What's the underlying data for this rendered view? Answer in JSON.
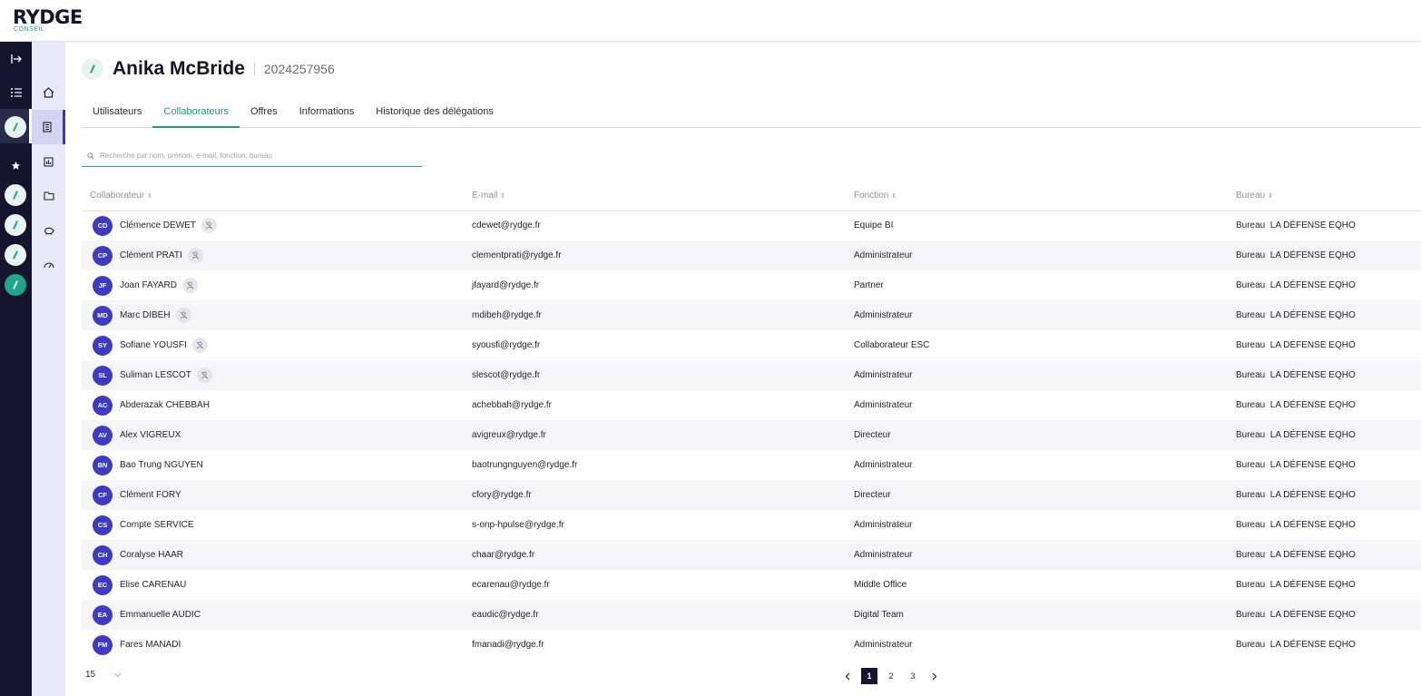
{
  "brand": {
    "name": "RYDGE",
    "sub": "CONSEIL"
  },
  "rail": {
    "items": [
      "expand-icon",
      "list-icon",
      "client-item-1",
      "favorites-icon",
      "client-item-2",
      "client-item-3",
      "client-item-4",
      "client-item-5"
    ]
  },
  "sidebar": {
    "items": [
      "home-icon",
      "building-icon",
      "report-icon",
      "folder-icon",
      "piggy-bank-icon",
      "gauge-icon"
    ]
  },
  "header": {
    "title": "Anika McBride",
    "id": "2024257956"
  },
  "tabs": [
    {
      "label": "Utilisateurs",
      "active": false
    },
    {
      "label": "Collaborateurs",
      "active": true
    },
    {
      "label": "Offres",
      "active": false
    },
    {
      "label": "Informations",
      "active": false
    },
    {
      "label": "Historique des délégations",
      "active": false
    }
  ],
  "search": {
    "placeholder": "Recherche par nom, prénom, e-mail, fonction, bureau"
  },
  "table": {
    "columns": [
      "Collaborateur",
      "E-mail",
      "Fonction",
      "Bureau"
    ],
    "rows": [
      {
        "initials": "CD",
        "name": "Clémence DEWET",
        "delegate": true,
        "email": "cdewet@rydge.fr",
        "function": "Equipe BI",
        "office": "Bureau  LA DÉFENSE EQHO"
      },
      {
        "initials": "CP",
        "name": "Clément PRATI",
        "delegate": true,
        "email": "clementprati@rydge.fr",
        "function": "Administrateur",
        "office": "Bureau  LA DÉFENSE EQHO"
      },
      {
        "initials": "JF",
        "name": "Joan FAYARD",
        "delegate": true,
        "email": "jfayard@rydge.fr",
        "function": "Partner",
        "office": "Bureau  LA DÉFENSE EQHO"
      },
      {
        "initials": "MD",
        "name": "Marc DIBEH",
        "delegate": true,
        "email": "mdibeh@rydge.fr",
        "function": "Administrateur",
        "office": "Bureau  LA DÉFENSE EQHO"
      },
      {
        "initials": "SY",
        "name": "Sofiane YOUSFI",
        "delegate": true,
        "email": "syousfi@rydge.fr",
        "function": "Collaborateur ESC",
        "office": "Bureau  LA DÉFENSE EQHO"
      },
      {
        "initials": "SL",
        "name": "Suliman LESCOT",
        "delegate": true,
        "email": "slescot@rydge.fr",
        "function": "Administrateur",
        "office": "Bureau  LA DÉFENSE EQHO"
      },
      {
        "initials": "AC",
        "name": "Abderazak CHEBBAH",
        "delegate": false,
        "email": "achebbah@rydge.fr",
        "function": "Administrateur",
        "office": "Bureau  LA DÉFENSE EQHO"
      },
      {
        "initials": "AV",
        "name": "Alex VIGREUX",
        "delegate": false,
        "email": "avigreux@rydge.fr",
        "function": "Directeur",
        "office": "Bureau  LA DÉFENSE EQHO"
      },
      {
        "initials": "BN",
        "name": "Bao Trung NGUYEN",
        "delegate": false,
        "email": "baotrungnguyen@rydge.fr",
        "function": "Administrateur",
        "office": "Bureau  LA DÉFENSE EQHO"
      },
      {
        "initials": "CF",
        "name": "Clément FORY",
        "delegate": false,
        "email": "cfory@rydge.fr",
        "function": "Directeur",
        "office": "Bureau  LA DÉFENSE EQHO"
      },
      {
        "initials": "CS",
        "name": "Compte SERVICE",
        "delegate": false,
        "email": "s-onp-hpulse@rydge.fr",
        "function": "Administrateur",
        "office": "Bureau  LA DÉFENSE EQHO"
      },
      {
        "initials": "CH",
        "name": "Coralyse HAAR",
        "delegate": false,
        "email": "chaar@rydge.fr",
        "function": "Administrateur",
        "office": "Bureau  LA DÉFENSE EQHO"
      },
      {
        "initials": "EC",
        "name": "Elise CARENAU",
        "delegate": false,
        "email": "ecarenau@rydge.fr",
        "function": "Middle Office",
        "office": "Bureau  LA DÉFENSE EQHO"
      },
      {
        "initials": "EA",
        "name": "Emmanuelle AUDIC",
        "delegate": false,
        "email": "eaudic@rydge.fr",
        "function": "Digital Team",
        "office": "Bureau  LA DÉFENSE EQHO"
      },
      {
        "initials": "FM",
        "name": "Fares MANADI",
        "delegate": false,
        "email": "fmanadi@rydge.fr",
        "function": "Administrateur",
        "office": "Bureau  LA DÉFENSE EQHO"
      }
    ]
  },
  "pagination": {
    "page_size": "15",
    "pages": [
      "1",
      "2",
      "3"
    ],
    "current": "1"
  },
  "colors": {
    "accent": "#1fa58a",
    "avatar": "#3d3bc4",
    "rail": "#14142e",
    "sidebar": "#e9e9f9"
  }
}
